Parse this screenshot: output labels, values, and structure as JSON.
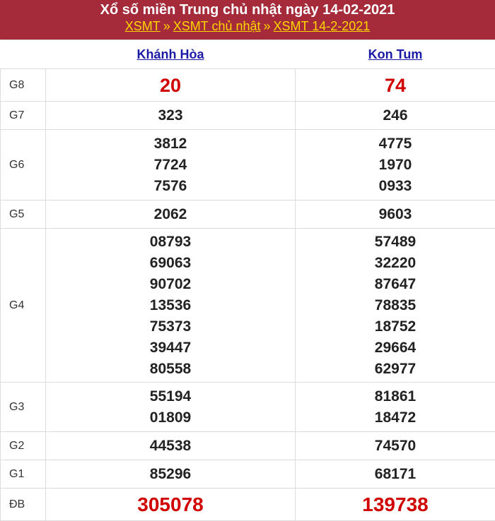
{
  "header": {
    "title": "Xổ số miền Trung chủ nhật ngày 14-02-2021",
    "crumbs": [
      "XSMT",
      "XSMT chủ nhật",
      "XSMT 14-2-2021"
    ],
    "separator": "»"
  },
  "provinces": [
    "Khánh Hòa",
    "Kon Tum"
  ],
  "prizes": [
    {
      "label": "G8",
      "values": [
        [
          "20"
        ],
        [
          "74"
        ]
      ],
      "highlight": true
    },
    {
      "label": "G7",
      "values": [
        [
          "323"
        ],
        [
          "246"
        ]
      ]
    },
    {
      "label": "G6",
      "values": [
        [
          "3812",
          "7724",
          "7576"
        ],
        [
          "4775",
          "1970",
          "0933"
        ]
      ]
    },
    {
      "label": "G5",
      "values": [
        [
          "2062"
        ],
        [
          "9603"
        ]
      ]
    },
    {
      "label": "G4",
      "values": [
        [
          "08793",
          "69063",
          "90702",
          "13536",
          "75373",
          "39447",
          "80558"
        ],
        [
          "57489",
          "32220",
          "87647",
          "78835",
          "18752",
          "29664",
          "62977"
        ]
      ]
    },
    {
      "label": "G3",
      "values": [
        [
          "55194",
          "01809"
        ],
        [
          "81861",
          "18472"
        ]
      ]
    },
    {
      "label": "G2",
      "values": [
        [
          "44538"
        ],
        [
          "74570"
        ]
      ]
    },
    {
      "label": "G1",
      "values": [
        [
          "85296"
        ],
        [
          "68171"
        ]
      ]
    },
    {
      "label": "ĐB",
      "values": [
        [
          "305078"
        ],
        [
          "139738"
        ]
      ],
      "highlight": true
    }
  ],
  "colors": {
    "header_bg": "#a52a3a",
    "link_yellow": "#ffd700",
    "highlight_red": "#d00000",
    "province_link": "#1a1aa6"
  }
}
